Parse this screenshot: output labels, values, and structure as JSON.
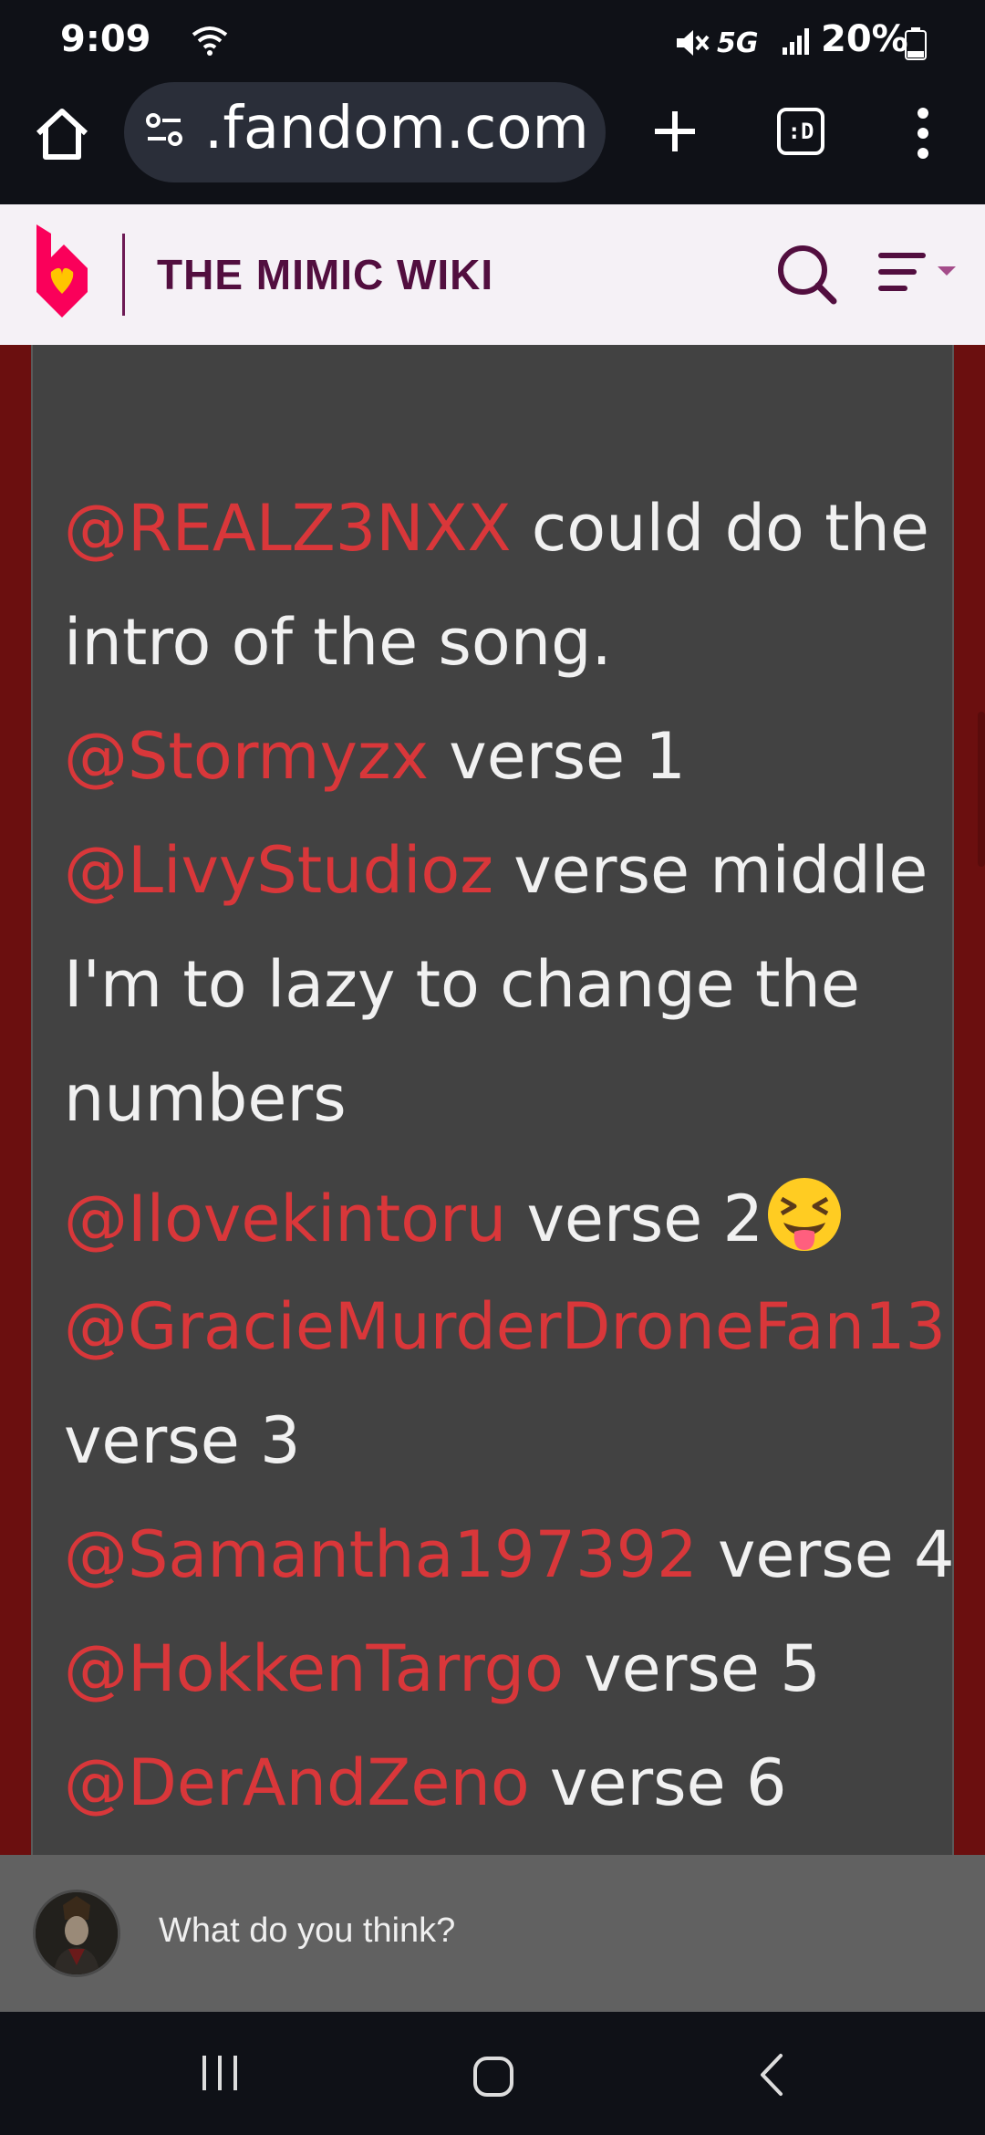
{
  "status_bar": {
    "time": "9:09",
    "network": "5G",
    "battery": "20%"
  },
  "browser": {
    "url": ".fandom.com",
    "tabs_label": ":D"
  },
  "wiki": {
    "title": "THE MIMIC WIKI"
  },
  "comment": {
    "lines": [
      {
        "mention": "@REALZ3NXX",
        "text": " could do the"
      },
      {
        "mention": "",
        "text": "intro of the song."
      },
      {
        "mention": "@Stormyzx",
        "text": " verse 1"
      },
      {
        "mention": "@LivyStudioz",
        "text": " verse middle"
      },
      {
        "mention": "",
        "text": "I'm to lazy to change the"
      },
      {
        "mention": "",
        "text": "numbers"
      },
      {
        "mention": "@Ilovekintoru",
        "text": " verse 2"
      },
      {
        "mention": "@GracieMurderDroneFan13",
        "text": ""
      },
      {
        "mention": "",
        "text": "verse 3"
      },
      {
        "mention": "@Samantha197392",
        "text": " verse 4"
      },
      {
        "mention": "@HokkenTarrgo",
        "text": " verse 5"
      },
      {
        "mention": "@DerAndZeno",
        "text": " verse 6"
      }
    ],
    "emoji": "squinting-tongue-emoji"
  },
  "reply": {
    "placeholder": "What do you think?"
  },
  "colors": {
    "mention": "#d9373a",
    "panel": "#424242",
    "page_bg": "#6b0f0f",
    "wiki_title": "#520e3f",
    "fandom_pink": "#fa005a"
  }
}
